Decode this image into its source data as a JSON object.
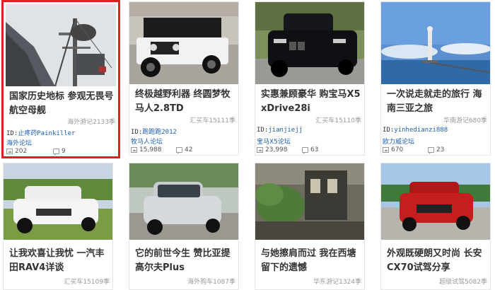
{
  "cards": [
    {
      "title": "国家历史地标 参观无畏号航空母舰",
      "source": "海外游记2133季",
      "user_prefix": "ID:",
      "user": "止疼药Painkiller",
      "forum": "海外论坛",
      "images": "202",
      "comments": "9",
      "selected": true
    },
    {
      "title": "终极越野利器 终圆梦牧马人2.8TD",
      "source": "汇买车15111季",
      "user_prefix": "ID:",
      "user": "跑跑跑2012",
      "forum": "牧马人论坛",
      "images": "15,988",
      "comments": "42",
      "selected": false
    },
    {
      "title": "实惠兼顾豪华 购宝马X5 xDrive28i",
      "source": "汇买车15110季",
      "user_prefix": "ID:",
      "user": "jianjiejj",
      "forum": "宝马X5论坛",
      "images": "23,998",
      "comments": "63",
      "selected": false
    },
    {
      "title": "一次说走就走的旅行 海南三亚之旅",
      "source": "华南游记680季",
      "user_prefix": "ID:",
      "user": "yinhedianzi888",
      "forum": "欧力威论坛",
      "images": "670",
      "comments": "23",
      "selected": false
    },
    {
      "title": "让我欢喜让我忧 一汽丰田RAV4详谈",
      "source": "汇买车15109季",
      "selected": false
    },
    {
      "title": "它的前世今生 赞比亚提高尔夫Plus",
      "source": "海外购车1087季",
      "selected": false
    },
    {
      "title": "与她擦肩而过 我在西塘留下的遗憾",
      "source": "华东游记1324季",
      "selected": false
    },
    {
      "title": "外观既硬朗又时尚 长安CX70试驾分享",
      "source": "超级试驾5082季",
      "selected": false
    }
  ],
  "colors": {
    "link": "#1a5fb4",
    "selected_border": "#e02020",
    "meta": "#999999"
  }
}
